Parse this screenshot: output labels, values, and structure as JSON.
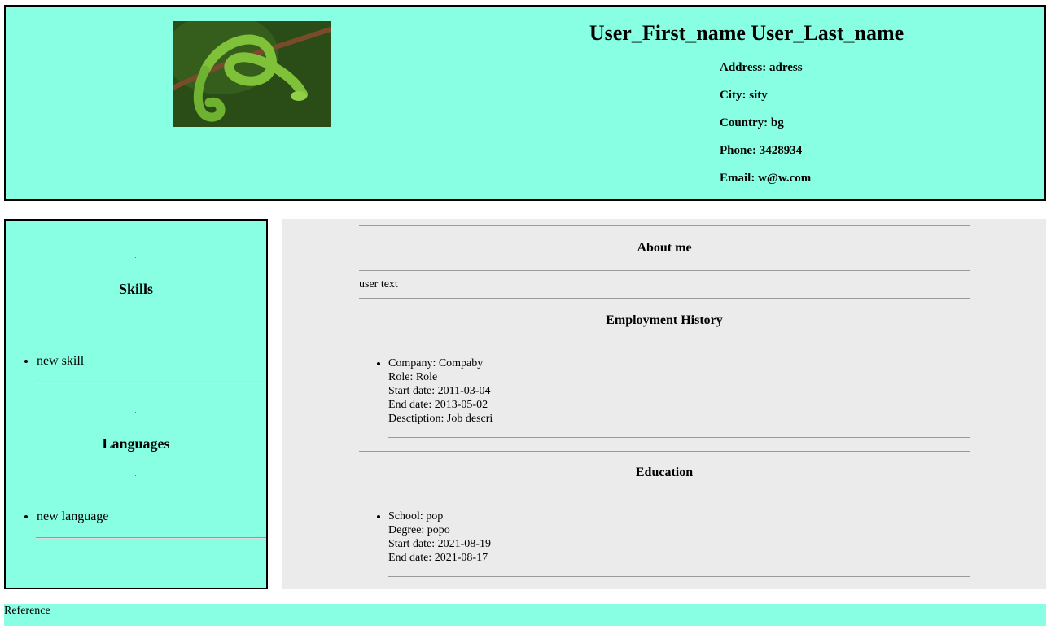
{
  "header": {
    "name": "User_First_name User_Last_name",
    "photo_icon": "snake-photo",
    "contact": {
      "address": "Address: adress",
      "city": "City: sity",
      "country": "Country: bg",
      "phone": "Phone: 3428934",
      "email": "Email: w@w.com"
    }
  },
  "sidebar": {
    "skills_title": "Skills",
    "skills": [
      "new skill"
    ],
    "languages_title": "Languages",
    "languages": [
      "new language"
    ]
  },
  "main": {
    "about_title": "About me",
    "about_text": "user text",
    "employment_title": "Employment History",
    "employment": [
      {
        "company": "Company: Compaby",
        "role": "Role: Role",
        "start": "Start date: 2011-03-04",
        "end": "End date: 2013-05-02",
        "description": "Desctiption: Job descri"
      }
    ],
    "education_title": "Education",
    "education": [
      {
        "school": "School: pop",
        "degree": "Degree: popo",
        "start": "Start date: 2021-08-19",
        "end": "End date: 2021-08-17"
      }
    ]
  },
  "footer": {
    "label": "Reference"
  },
  "colors": {
    "accent": "#88ffe2",
    "panel": "#ebebeb"
  }
}
